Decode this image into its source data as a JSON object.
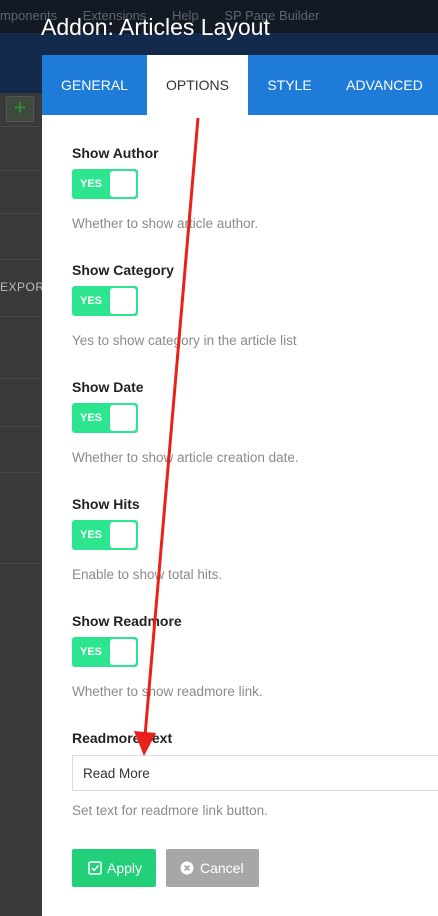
{
  "background": {
    "menu": [
      "mponents",
      "Extensions",
      "Help",
      "SP Page Builder"
    ],
    "export_label": "EXPOR"
  },
  "modal": {
    "title": "Addon: Articles Layout",
    "tabs": [
      {
        "label": "GENERAL",
        "active": false
      },
      {
        "label": "OPTIONS",
        "active": true
      },
      {
        "label": "STYLE",
        "active": false
      },
      {
        "label": "ADVANCED",
        "active": false
      }
    ],
    "fields": [
      {
        "label": "Show Author",
        "toggle": "YES",
        "help": "Whether to show article author."
      },
      {
        "label": "Show Category",
        "toggle": "YES",
        "help": "Yes to show category in the article list"
      },
      {
        "label": "Show Date",
        "toggle": "YES",
        "help": "Whether to show article creation date."
      },
      {
        "label": "Show Hits",
        "toggle": "YES",
        "help": "Enable to show total hits."
      },
      {
        "label": "Show Readmore",
        "toggle": "YES",
        "help": "Whether to show readmore link."
      }
    ],
    "readmore": {
      "label": "Readmore Text",
      "value": "Read More",
      "help": "Set text for readmore link button."
    },
    "buttons": {
      "apply": "Apply",
      "cancel": "Cancel"
    }
  },
  "colors": {
    "tab_bar": "#1e7bd8",
    "toggle_on": "#2ee58f",
    "apply": "#23d07a",
    "cancel": "#a7a7a7",
    "annotation_arrow": "#e8221b"
  }
}
